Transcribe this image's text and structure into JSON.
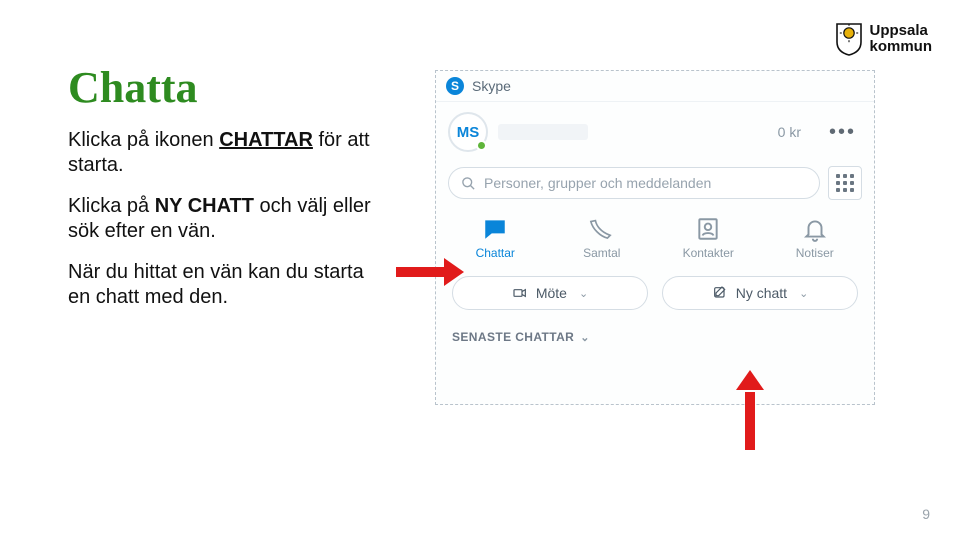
{
  "logo": {
    "line1": "Uppsala",
    "line2": "kommun"
  },
  "title": "Chatta",
  "paragraphs": {
    "p1_a": "Klicka på ikonen ",
    "p1_b": "CHATTAR",
    "p1_c": " för att starta.",
    "p2_a": "Klicka på ",
    "p2_b": "NY CHATT",
    "p2_c": " och välj eller sök efter en vän.",
    "p3": "När du hittat en vän kan du starta en chatt med den."
  },
  "skype": {
    "app_name": "Skype",
    "avatar_initials": "MS",
    "balance": "0 kr",
    "more_glyph": "•••",
    "search_placeholder": "Personer, grupper och meddelanden",
    "tabs": {
      "chats": "Chattar",
      "calls": "Samtal",
      "contacts": "Kontakter",
      "notices": "Notiser"
    },
    "actions": {
      "meeting": "Möte",
      "new_chat": "Ny chatt"
    },
    "section_recent": "SENASTE CHATTAR"
  },
  "page_number": "9"
}
